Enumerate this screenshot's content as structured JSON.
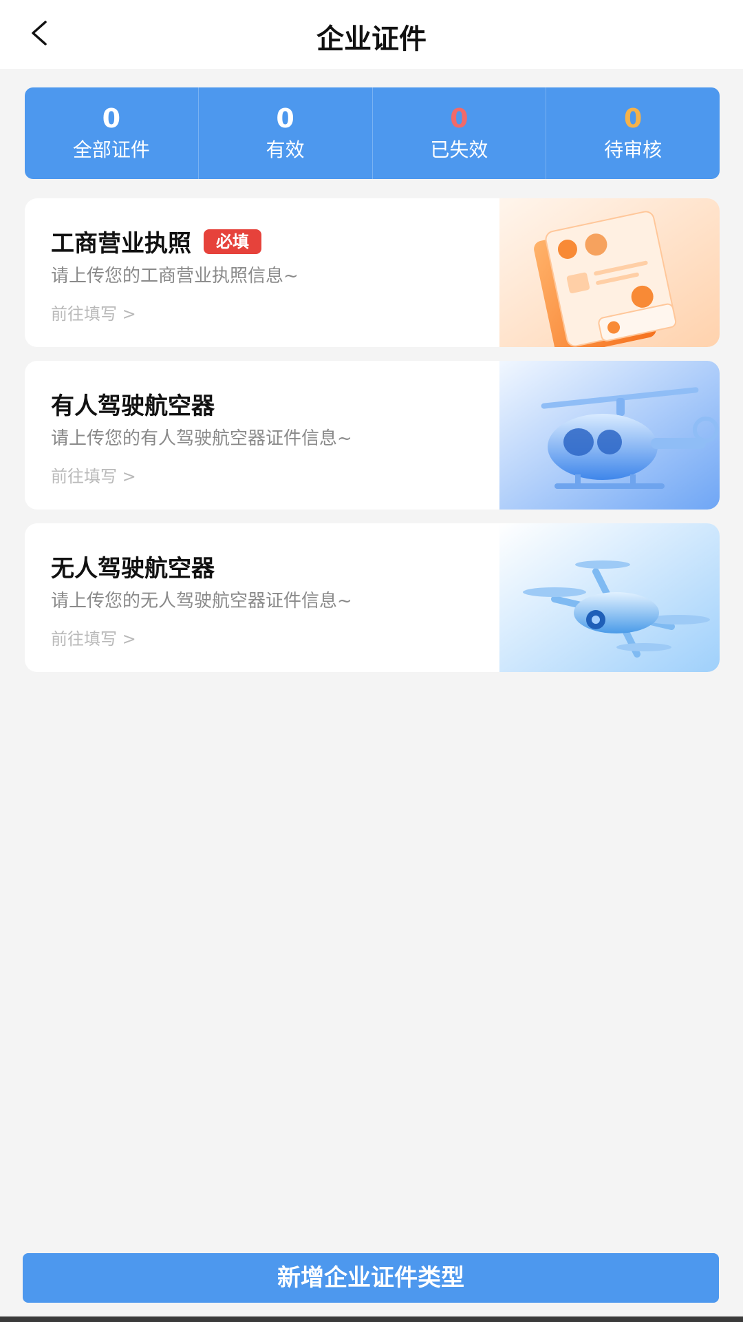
{
  "header": {
    "title": "企业证件"
  },
  "stats": [
    {
      "value": "0",
      "label": "全部证件",
      "color": "#ffffff"
    },
    {
      "value": "0",
      "label": "有效",
      "color": "#ffffff"
    },
    {
      "value": "0",
      "label": "已失效",
      "color": "#f06a6a"
    },
    {
      "value": "0",
      "label": "待审核",
      "color": "#f5b24a"
    }
  ],
  "cards": [
    {
      "title": "工商营业执照",
      "badge": "必填",
      "desc": "请上传您的工商营业执照信息~",
      "link": "前往填写 >",
      "icon": "license-illustration"
    },
    {
      "title": "有人驾驶航空器",
      "desc": "请上传您的有人驾驶航空器证件信息~",
      "link": "前往填写 >",
      "icon": "helicopter-illustration"
    },
    {
      "title": "无人驾驶航空器",
      "desc": "请上传您的无人驾驶航空器证件信息~",
      "link": "前往填写 >",
      "icon": "drone-illustration"
    }
  ],
  "footer": {
    "add_button_label": "新增企业证件类型"
  },
  "colors": {
    "accent": "#4d98ee",
    "badge": "#e6423b"
  }
}
